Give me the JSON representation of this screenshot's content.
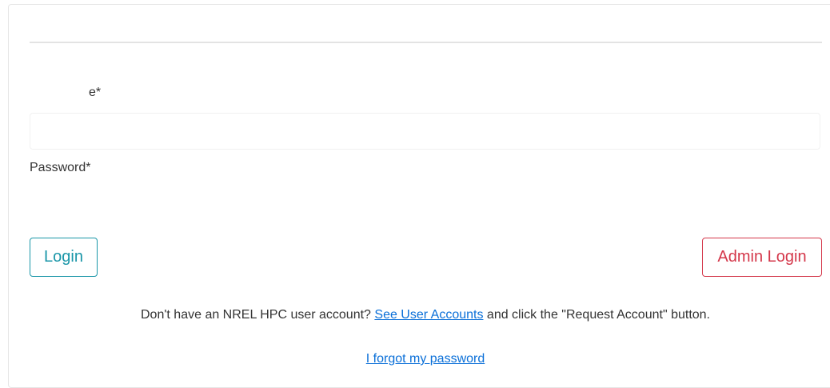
{
  "form": {
    "username_label": "e*",
    "username_value": "",
    "password_label": "Password*",
    "password_value": ""
  },
  "buttons": {
    "login_label": "Login",
    "admin_login_label": "Admin Login"
  },
  "footer": {
    "account_prefix": "Don't have an NREL HPC user account? ",
    "account_link": "See User Accounts",
    "account_suffix": " and click the \"Request Account\" button.",
    "forgot_link": "I forgot my password"
  },
  "colors": {
    "login_accent": "#1a96a8",
    "admin_accent": "#d4374a",
    "link": "#0a6fd8"
  }
}
